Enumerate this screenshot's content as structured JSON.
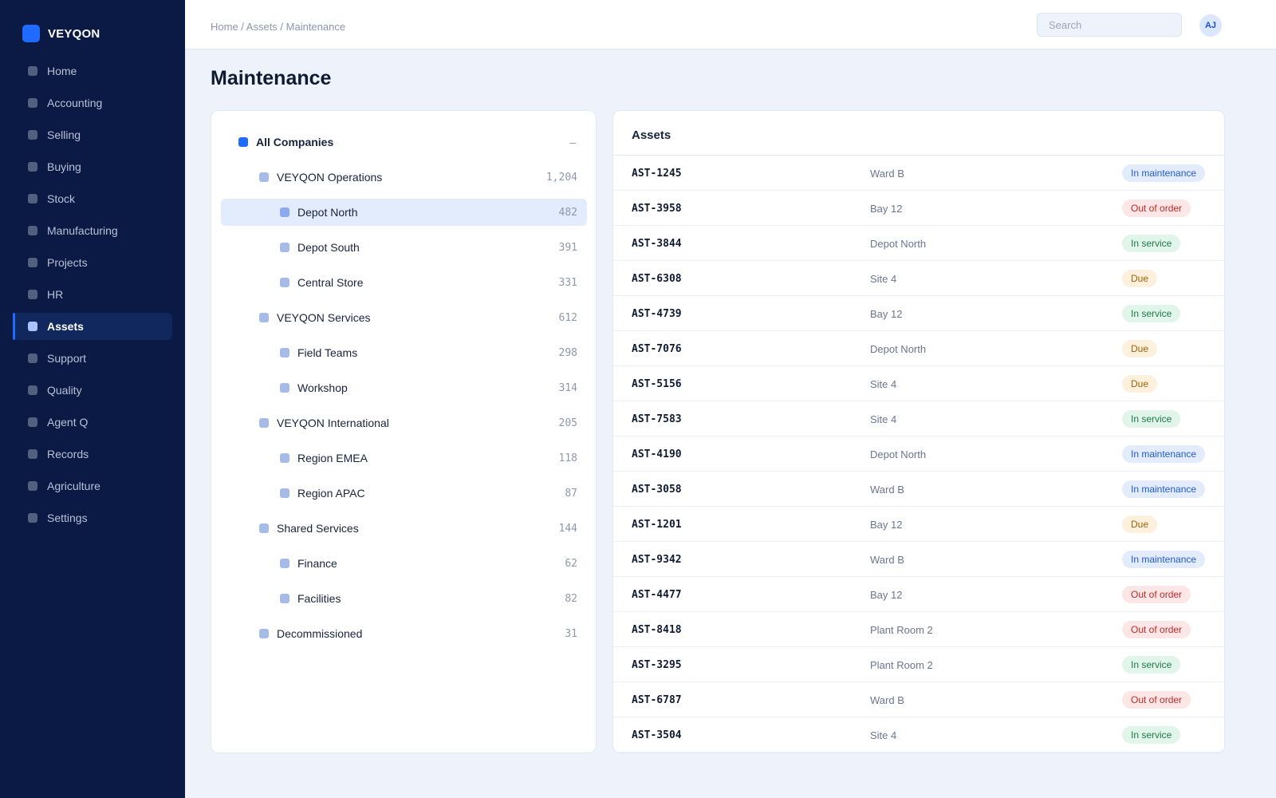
{
  "app": {
    "brand": "VEYQON"
  },
  "sidebar": {
    "items": [
      {
        "label": "Home",
        "active": false
      },
      {
        "label": "Accounting",
        "active": false
      },
      {
        "label": "Selling",
        "active": false
      },
      {
        "label": "Buying",
        "active": false
      },
      {
        "label": "Stock",
        "active": false
      },
      {
        "label": "Manufacturing",
        "active": false
      },
      {
        "label": "Projects",
        "active": false
      },
      {
        "label": "HR",
        "active": false
      },
      {
        "label": "Assets",
        "active": true
      },
      {
        "label": "Support",
        "active": false
      },
      {
        "label": "Quality",
        "active": false
      },
      {
        "label": "Agent Q",
        "active": false
      },
      {
        "label": "Records",
        "active": false
      },
      {
        "label": "Agriculture",
        "active": false
      },
      {
        "label": "Settings",
        "active": false
      }
    ]
  },
  "header": {
    "breadcrumb": "Home / Assets / Maintenance",
    "search_placeholder": "Search",
    "avatar_initials": "AJ"
  },
  "page": {
    "title": "Maintenance"
  },
  "tree": {
    "collapse_symbol": "–",
    "nodes": [
      {
        "label": "All Companies",
        "count": "",
        "level": 0,
        "root": true
      },
      {
        "label": "VEYQON Operations",
        "count": "1,204",
        "level": 1
      },
      {
        "label": "Depot North",
        "count": "482",
        "level": 2,
        "selected": true
      },
      {
        "label": "Depot South",
        "count": "391",
        "level": 2
      },
      {
        "label": "Central Store",
        "count": "331",
        "level": 2
      },
      {
        "label": "VEYQON Services",
        "count": "612",
        "level": 1
      },
      {
        "label": "Field Teams",
        "count": "298",
        "level": 2
      },
      {
        "label": "Workshop",
        "count": "314",
        "level": 2
      },
      {
        "label": "VEYQON International",
        "count": "205",
        "level": 1
      },
      {
        "label": "Region EMEA",
        "count": "118",
        "level": 2
      },
      {
        "label": "Region APAC",
        "count": "87",
        "level": 2
      },
      {
        "label": "Shared Services",
        "count": "144",
        "level": 1
      },
      {
        "label": "Finance",
        "count": "62",
        "level": 2
      },
      {
        "label": "Facilities",
        "count": "82",
        "level": 2
      },
      {
        "label": "Decommissioned",
        "count": "31",
        "level": 1
      }
    ]
  },
  "assets": {
    "title": "Assets",
    "status_colors": {
      "In maintenance": "#1f5bd8",
      "Out of order": "#c62828",
      "In service": "#1d7a45",
      "Due": "#a45f07"
    },
    "rows": [
      {
        "id": "AST-1245",
        "location": "Ward B",
        "status": "In maintenance"
      },
      {
        "id": "AST-3958",
        "location": "Bay 12",
        "status": "Out of order"
      },
      {
        "id": "AST-3844",
        "location": "Depot North",
        "status": "In service"
      },
      {
        "id": "AST-6308",
        "location": "Site 4",
        "status": "Due"
      },
      {
        "id": "AST-4739",
        "location": "Bay 12",
        "status": "In service"
      },
      {
        "id": "AST-7076",
        "location": "Depot North",
        "status": "Due"
      },
      {
        "id": "AST-5156",
        "location": "Site 4",
        "status": "Due"
      },
      {
        "id": "AST-7583",
        "location": "Site 4",
        "status": "In service"
      },
      {
        "id": "AST-4190",
        "location": "Depot North",
        "status": "In maintenance"
      },
      {
        "id": "AST-3058",
        "location": "Ward B",
        "status": "In maintenance"
      },
      {
        "id": "AST-1201",
        "location": "Bay 12",
        "status": "Due"
      },
      {
        "id": "AST-9342",
        "location": "Ward B",
        "status": "In maintenance"
      },
      {
        "id": "AST-4477",
        "location": "Bay 12",
        "status": "Out of order"
      },
      {
        "id": "AST-8418",
        "location": "Plant Room 2",
        "status": "Out of order"
      },
      {
        "id": "AST-3295",
        "location": "Plant Room 2",
        "status": "In service"
      },
      {
        "id": "AST-6787",
        "location": "Ward B",
        "status": "Out of order"
      },
      {
        "id": "AST-3504",
        "location": "Site 4",
        "status": "In service"
      }
    ]
  }
}
